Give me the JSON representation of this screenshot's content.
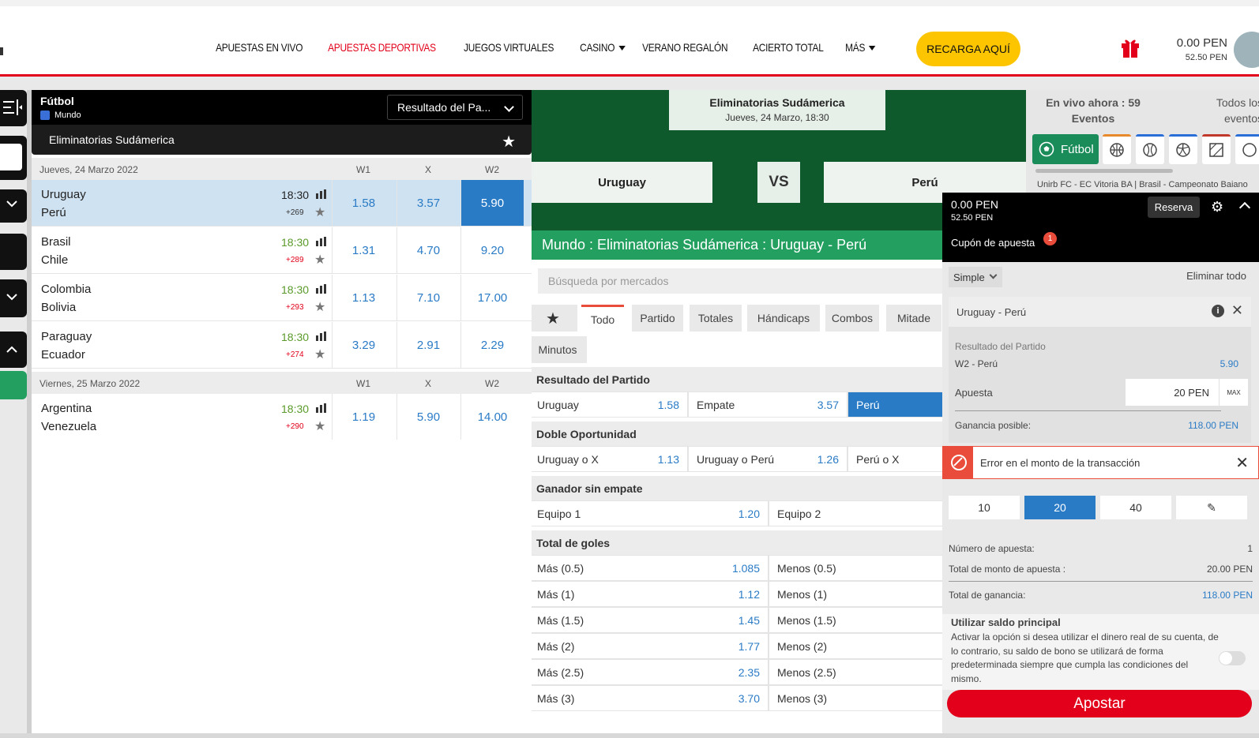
{
  "nav": {
    "items": [
      {
        "label": "APUESTAS EN VIVO",
        "active": false,
        "dropdown": false
      },
      {
        "label": "APUESTAS DEPORTIVAS",
        "active": true,
        "dropdown": false
      },
      {
        "label": "JUEGOS VIRTUALES",
        "active": false,
        "dropdown": false
      },
      {
        "label": "CASINO",
        "active": false,
        "dropdown": true
      },
      {
        "label": "VERANO REGALÓN",
        "active": false,
        "dropdown": false
      },
      {
        "label": "ACIERTO TOTAL",
        "active": false,
        "dropdown": false
      },
      {
        "label": "MÁS",
        "active": false,
        "dropdown": true
      }
    ],
    "recharge_label": "RECARGA AQUÍ",
    "balance_main": "0.00 PEN",
    "balance_bonus": "52.50 PEN",
    "accent": "#e2001a"
  },
  "left": {
    "sport": "Fútbol",
    "region": "Mundo",
    "market_select": "Resultado del Pa...",
    "league": "Eliminatorias Sudámerica",
    "groups": [
      {
        "date": "Jueves, 24 Marzo 2022",
        "headers": [
          "W1",
          "X",
          "W2"
        ],
        "matches": [
          {
            "home": "Uruguay",
            "away": "Perú",
            "time": "18:30",
            "more": "+269",
            "odds": [
              "1.58",
              "3.57",
              "5.90"
            ],
            "selected": true
          },
          {
            "home": "Brasil",
            "away": "Chile",
            "time": "18:30",
            "more": "+289",
            "odds": [
              "1.31",
              "4.70",
              "9.20"
            ],
            "selected": false
          },
          {
            "home": "Colombia",
            "away": "Bolivia",
            "time": "18:30",
            "more": "+293",
            "odds": [
              "1.13",
              "7.10",
              "17.00"
            ],
            "selected": false
          },
          {
            "home": "Paraguay",
            "away": "Ecuador",
            "time": "18:30",
            "more": "+274",
            "odds": [
              "3.29",
              "2.91",
              "2.29"
            ],
            "selected": false
          }
        ]
      },
      {
        "date": "Viernes, 25 Marzo 2022",
        "headers": [
          "W1",
          "X",
          "W2"
        ],
        "matches": [
          {
            "home": "Argentina",
            "away": "Venezuela",
            "time": "18:30",
            "more": "+290",
            "odds": [
              "1.19",
              "5.90",
              "14.00"
            ],
            "selected": false
          }
        ]
      }
    ]
  },
  "center": {
    "league": "Eliminatorias Sudámerica",
    "datetime": "Jueves, 24 Marzo, 18:30",
    "home": "Uruguay",
    "vs": "VS",
    "away": "Perú",
    "title": "Mundo : Eliminatorias Sudámerica : Uruguay - Perú",
    "search_placeholder": "Búsqueda por mercados",
    "tabs": [
      "Todo",
      "Partido",
      "Totales",
      "Hándicaps",
      "Combos",
      "Mitade",
      "Minutos"
    ],
    "markets": {
      "resultado": {
        "title": "Resultado del Partido",
        "count": "1",
        "cells": [
          [
            "Uruguay",
            "1.58"
          ],
          [
            "Empate",
            "3.57"
          ],
          [
            "Perú",
            ""
          ]
        ]
      },
      "doble": {
        "title": "Doble Oportunidad",
        "count": "1",
        "cells": [
          [
            "Uruguay o X",
            "1.13"
          ],
          [
            "Uruguay o Perú",
            "1.26"
          ],
          [
            "Perú o X",
            ""
          ]
        ]
      },
      "ganador": {
        "title": "Ganador sin empate",
        "cells": [
          [
            "Equipo 1",
            "1.20"
          ],
          [
            "Equipo 2",
            ""
          ]
        ]
      },
      "goles": {
        "title": "Total de goles",
        "count": "1",
        "rows": [
          [
            "Más (0.5)",
            "1.085",
            "Menos (0.5)"
          ],
          [
            "Más (1)",
            "1.12",
            "Menos (1)"
          ],
          [
            "Más (1.5)",
            "1.45",
            "Menos (1.5)"
          ],
          [
            "Más (2)",
            "1.77",
            "Menos (2)"
          ],
          [
            "Más (2.5)",
            "2.35",
            "Menos (2.5)"
          ],
          [
            "Más (3)",
            "3.70",
            "Menos (3)"
          ]
        ]
      }
    }
  },
  "live": {
    "title": "En vivo ahora : 59 Eventos",
    "all_events": "Todos los eventos",
    "chip_label": "Fútbol",
    "ticker": "Unirb FC - EC Vitoria BA | Brasil - Campeonato Baiano"
  },
  "slip": {
    "balance_main": "0.00 PEN",
    "balance_bonus": "52.50 PEN",
    "reserva": "Reserva",
    "coupon_label": "Cupón de apuesta",
    "coupon_badge": "1",
    "type": "Simple",
    "clear_all": "Eliminar todo",
    "event": "Uruguay - Perú",
    "market": "Resultado del Partido",
    "selection": "W2 - Perú",
    "selection_odd": "5.90",
    "stake_label": "Apuesta",
    "stake": "20 PEN",
    "max": "MAX",
    "possible_label": "Ganancia posible:",
    "possible_value": "118.00 PEN",
    "error": "Error en el monto de la transacción",
    "quick": [
      "10",
      "20",
      "40"
    ],
    "summary": [
      {
        "label": "Número de apuesta:",
        "value": "1"
      },
      {
        "label": "Total de monto de apuesta :",
        "value": "20.00 PEN"
      },
      {
        "label": "Total de ganancia:",
        "value": "118.00 PEN"
      }
    ],
    "principal_title": "Utilizar saldo principal",
    "principal_desc": "Activar la opción si desea utilizar el dinero real de su cuenta, de lo contrario, su saldo de bono se utilizará de forma predeterminada siempre que cumpla las condiciones del mismo.",
    "submit": "Apostar"
  }
}
